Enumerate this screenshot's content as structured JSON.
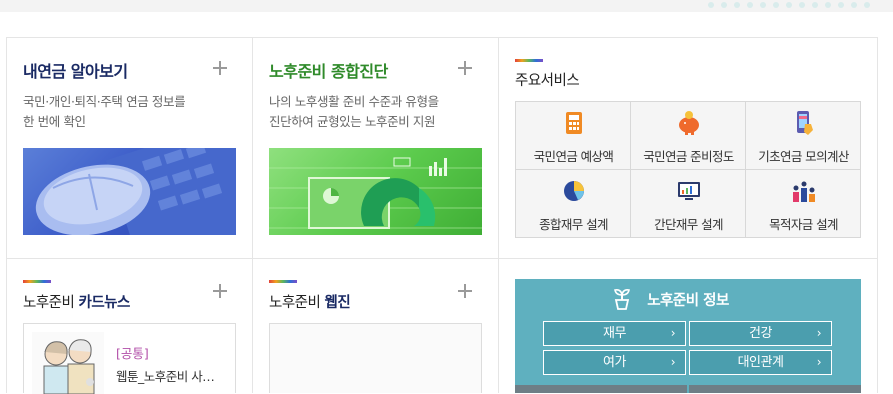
{
  "colors": {
    "navy": "#1a2a64",
    "green": "#2f8a2a",
    "teal": "#5fb0bf",
    "tag": "#b24ea8"
  },
  "pension": {
    "title": "내연금 알아보기",
    "desc_line1": "국민·개인·퇴직·주택 연금 정보를",
    "desc_line2": "한 번에 확인",
    "plus_icon": "plus-icon",
    "image": "mouse-keyboard-image"
  },
  "diagnosis": {
    "title": "노후준비 종합진단",
    "desc_line1": "나의 노후생활 준비 수준과 유형을",
    "desc_line2": "진단하여 균형있는 노후준비 지원",
    "plus_icon": "plus-icon",
    "image": "chart-graph-image"
  },
  "services": {
    "title": "주요서비스",
    "items": [
      {
        "label": "국민연금 예상액",
        "icon": "calculator-icon"
      },
      {
        "label": "국민연금 준비정도",
        "icon": "piggy-bank-icon"
      },
      {
        "label": "기초연금 모의계산",
        "icon": "phone-hand-icon"
      },
      {
        "label": "종합재무 설계",
        "icon": "pie-chart-icon"
      },
      {
        "label": "간단재무 설계",
        "icon": "monitor-chart-icon"
      },
      {
        "label": "목적자금 설계",
        "icon": "people-icon"
      }
    ]
  },
  "cardnews": {
    "title_prefix": "노후준비",
    "title_bold": "카드뉴스",
    "tag": "[공통]",
    "item_title": "웹툰_노후준비 사…",
    "thumb": "couple-cartoon-image"
  },
  "webzine": {
    "title_prefix": "노후준비",
    "title_bold": "웹진"
  },
  "info": {
    "title": "노후준비 정보",
    "icon": "plant-icon",
    "buttons": [
      {
        "label": "재무",
        "arrow": "›"
      },
      {
        "label": "건강",
        "arrow": "›"
      },
      {
        "label": "여가",
        "arrow": "›"
      },
      {
        "label": "대인관계",
        "arrow": "›"
      }
    ]
  }
}
